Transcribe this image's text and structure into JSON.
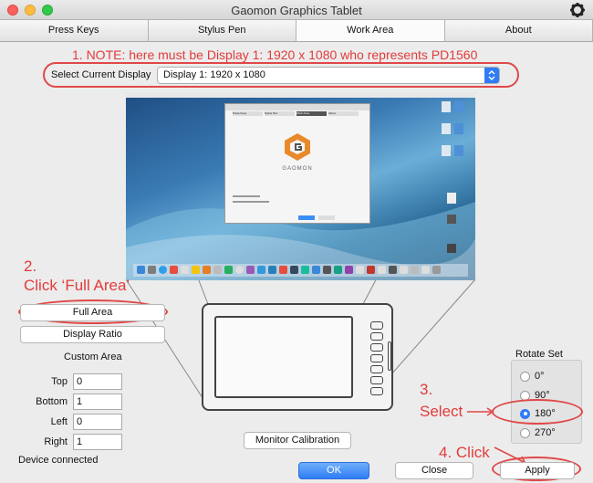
{
  "window": {
    "title": "Gaomon Graphics Tablet"
  },
  "tabs": [
    "Press Keys",
    "Stylus Pen",
    "Work Area",
    "About"
  ],
  "display": {
    "label": "Select Current Display",
    "value": "Display 1: 1920 x 1080"
  },
  "annotations": {
    "note1": "1. NOTE: here must be Display 1: 1920 x 1080 who represents PD1560",
    "step2_line1": "2.",
    "step2_line2": "Click ‘Full Area’",
    "step3_line1": "3.",
    "step3_line2": "Select",
    "step4": "4. Click"
  },
  "screen_preview": {
    "dialog_tabs": [
      "Press Keys",
      "Stylus Pen",
      "Work Area",
      "About"
    ],
    "logo_text": "GAOMON"
  },
  "buttons": {
    "full_area": "Full Area",
    "display_ratio": "Display Ratio",
    "monitor_calibration": "Monitor Calibration",
    "ok": "OK",
    "close": "Close",
    "apply": "Apply"
  },
  "custom_area": {
    "title": "Custom Area",
    "fields": [
      {
        "label": "Top",
        "value": "0"
      },
      {
        "label": "Bottom",
        "value": "1"
      },
      {
        "label": "Left",
        "value": "0"
      },
      {
        "label": "Right",
        "value": "1"
      }
    ]
  },
  "rotate": {
    "title": "Rotate Set",
    "options": [
      "0°",
      "90°",
      "180°",
      "270°"
    ],
    "selected": "180°"
  },
  "status": {
    "text": "Device connected"
  },
  "colors": {
    "annotation_red": "#e23b3b",
    "accent_blue": "#2f7cf6",
    "ok_blue": "#3b8ef5"
  }
}
